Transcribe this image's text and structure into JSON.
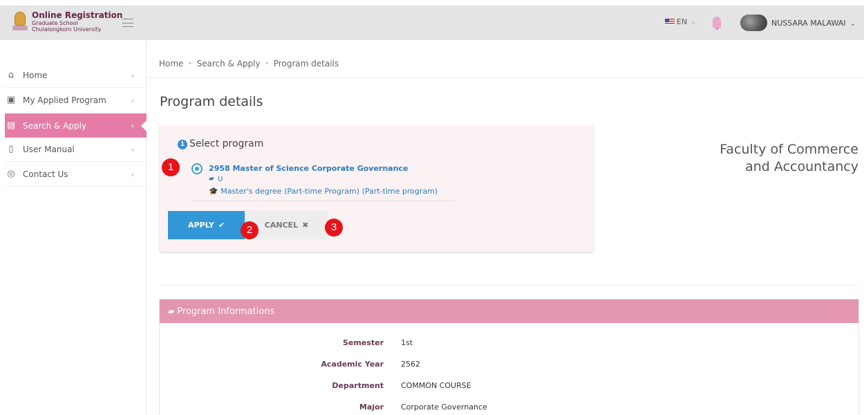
{
  "header": {
    "brand_title": "Online Registration",
    "brand_sub1": "Graduate School",
    "brand_sub2": "Chulalongkorn University",
    "language": "EN",
    "username": "NUSSARA MALAWAI"
  },
  "sidebar": {
    "items": [
      {
        "label": "Home",
        "icon": "home-icon"
      },
      {
        "label": "My Applied Program",
        "icon": "briefcase-icon"
      },
      {
        "label": "Search & Apply",
        "icon": "book-icon",
        "active": true
      },
      {
        "label": "User Manual",
        "icon": "manual-icon"
      },
      {
        "label": "Contact Us",
        "icon": "location-icon"
      }
    ]
  },
  "breadcrumb": [
    "Home",
    "Search & Apply",
    "Program details"
  ],
  "page_title": "Program details",
  "select_program": {
    "step": "1",
    "title": "Select program",
    "program_name": "2958 Master of Science Corporate Governance",
    "program_code": "U",
    "degree": "Master's degree (Part-time Program) (Part-time program)",
    "apply_label": "APPLY",
    "cancel_label": "CANCEL"
  },
  "markers": [
    "1",
    "2",
    "3"
  ],
  "faculty": {
    "line1": "Faculty of Commerce",
    "line2": "and Accountancy"
  },
  "program_info": {
    "heading": "Program Informations",
    "rows": [
      {
        "label": "Semester",
        "value": "1st"
      },
      {
        "label": "Academic Year",
        "value": "2562"
      },
      {
        "label": "Department",
        "value": "COMMON COURSE"
      },
      {
        "label": "Major",
        "value": "Corporate Governance"
      }
    ]
  },
  "colors": {
    "header_bg": "#e4e4e4",
    "active_nav": "#e47ca6",
    "apply_button": "#3197d6",
    "info_header": "#e496ae",
    "marker": "#e8141b",
    "link": "#2a7dbf"
  }
}
